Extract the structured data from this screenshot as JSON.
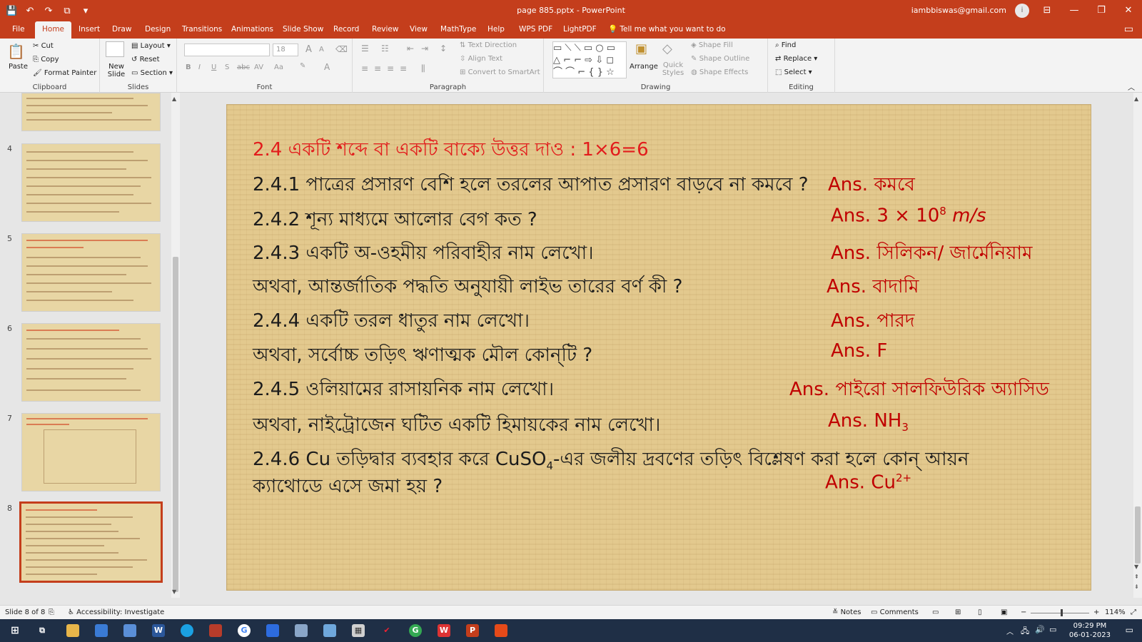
{
  "titlebar": {
    "qat": {
      "save": "💾",
      "undo": "↶",
      "redo": "↷",
      "slideshow": "⧉",
      "more": "▾"
    },
    "doc_title": "page 885.pptx  -  PowerPoint",
    "account": "iambbiswas@gmail.com",
    "avatar": "i",
    "win": {
      "ribbon_opts": "⊟",
      "minimize": "—",
      "restore": "❐",
      "close": "✕"
    }
  },
  "tabs": [
    "File",
    "Home",
    "Insert",
    "Draw",
    "Design",
    "Transitions",
    "Animations",
    "Slide Show",
    "Record",
    "Review",
    "View",
    "MathType",
    "Help",
    "WPS PDF",
    "LightPDF"
  ],
  "tell_me": "Tell me what you want to do",
  "ribbon": {
    "clipboard": {
      "paste": "Paste",
      "cut": "Cut",
      "copy": "Copy",
      "format_painter": "Format Painter",
      "label": "Clipboard"
    },
    "slides": {
      "new_slide": "New Slide",
      "layout": "Layout",
      "reset": "Reset",
      "section": "Section",
      "label": "Slides"
    },
    "font": {
      "size": "18",
      "label": "Font",
      "bold": "B",
      "italic": "I",
      "underline": "U",
      "strike": "S",
      "abc": "abc",
      "av": "AV",
      "aa": "Aa",
      "grow": "A",
      "shrink": "A"
    },
    "paragraph": {
      "text_direction": "Text Direction",
      "align_text": "Align Text",
      "convert": "Convert to SmartArt",
      "label": "Paragraph"
    },
    "drawing": {
      "arrange": "Arrange",
      "quick_styles": "Quick Styles",
      "shape_fill": "Shape Fill",
      "shape_outline": "Shape Outline",
      "shape_effects": "Shape Effects",
      "label": "Drawing"
    },
    "editing": {
      "find": "Find",
      "replace": "Replace",
      "select": "Select",
      "label": "Editing"
    }
  },
  "thumbnails": [
    {
      "num": "",
      "top": true
    },
    {
      "num": "4"
    },
    {
      "num": "5"
    },
    {
      "num": "6"
    },
    {
      "num": "7"
    },
    {
      "num": "8",
      "selected": true
    }
  ],
  "slide": {
    "heading": "2.4 একটি শব্দে বা একটি বাক্যে উত্তর দাও :  1×6=6",
    "q1": "2.4.1 পাত্রের প্রসারণ বেশি হলে তরলের আপাত প্রসারণ বাড়বে না কমবে ?",
    "a1": "Ans. কমবে",
    "q2": "2.4.2 শূন্য মাধ্যমে আলোর বেগ কত ?",
    "a2_prefix": "Ans. 3 × 10",
    "a2_exp": "8",
    "a2_unit": " m/s",
    "q3": "2.4.3 একটি অ-ওহমীয় পরিবাহীর নাম লেখো।",
    "a3": "Ans. সিলিকন/ জার্মেনিয়াম",
    "q3b": "অথবা, আন্তর্জাতিক পদ্ধতি অনুযায়ী লাইভ তারের বর্ণ কী ?",
    "a3b": "Ans. বাদামি",
    "q4": "2.4.4 একটি তরল ধাতুর নাম লেখো।",
    "a4": "Ans. পারদ",
    "q4b": "অথবা, সর্বোচ্চ তড়িৎ ঋণাত্মক মৌল কোন্‌টি ?",
    "a4b": "Ans. F",
    "q5": "2.4.5 ওলিয়ামের রাসায়নিক নাম লেখো।",
    "a5": "Ans. পাইরো সালফিউরিক অ্যাসিড",
    "q5b": "অথবা, নাইট্রোজেন ঘটিত একটি হিমায়কের নাম লেখো।",
    "a5b_prefix": "Ans. NH",
    "a5b_sub": "3",
    "q6_prefix": "2.4.6 Cu তড়িদ্বার ব্যবহার করে CuSO",
    "q6_sub": "4",
    "q6_suffix": "-এর জলীয় দ্রবণের তড়িৎ বিশ্লেষণ করা হলে কোন্ আয়ন",
    "q6_line2": "ক্যাথোডে এসে জমা হয় ?",
    "a6_prefix": "Ans. Cu",
    "a6_sup": "2+"
  },
  "status": {
    "slide_of": "Slide 8 of 8",
    "accessibility": "Accessibility: Investigate",
    "notes": "Notes",
    "comments": "Comments",
    "zoom": "114%"
  },
  "taskbar": {
    "time": "09:29 PM",
    "date": "06-01-2023"
  }
}
